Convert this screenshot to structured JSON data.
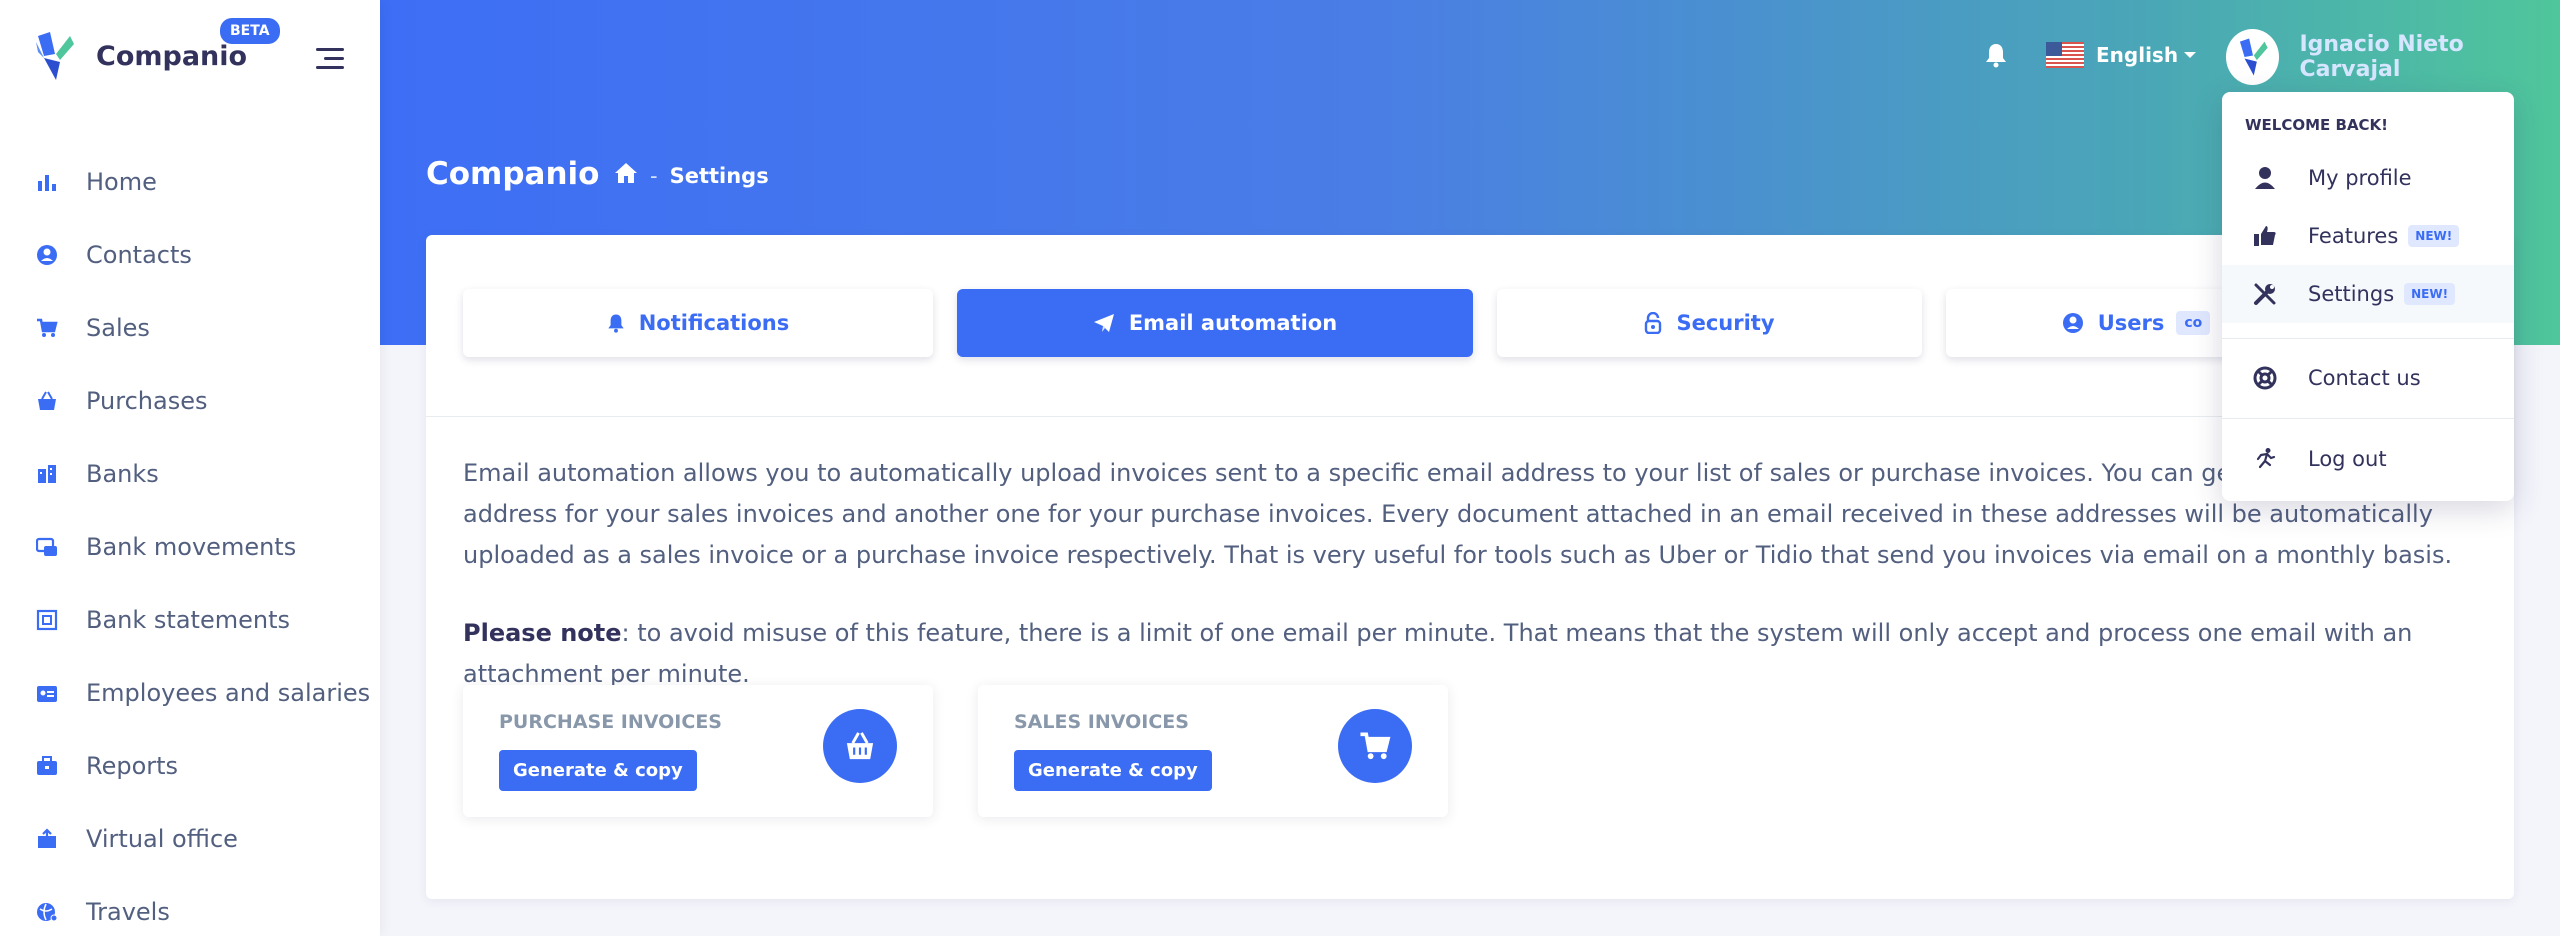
{
  "app": {
    "name": "Companio",
    "badge": "BETA"
  },
  "sidebar": {
    "items": [
      {
        "label": "Home",
        "icon": "bar-chart-icon"
      },
      {
        "label": "Contacts",
        "icon": "user-circle-icon"
      },
      {
        "label": "Sales",
        "icon": "cart-icon"
      },
      {
        "label": "Purchases",
        "icon": "basket-icon"
      },
      {
        "label": "Banks",
        "icon": "bank-icon"
      },
      {
        "label": "Bank movements",
        "icon": "transfer-icon"
      },
      {
        "label": "Bank statements",
        "icon": "statement-icon"
      },
      {
        "label": "Employees and salaries",
        "icon": "id-badge-icon"
      },
      {
        "label": "Reports",
        "icon": "briefcase-icon"
      },
      {
        "label": "Virtual office",
        "icon": "office-box-icon"
      },
      {
        "label": "Travels",
        "icon": "globe-icon"
      }
    ]
  },
  "header": {
    "language": "English",
    "user_name": "Ignacio Nieto Carvajal",
    "page_title": "Companio",
    "breadcrumb": {
      "separator": "-",
      "current": "Settings"
    }
  },
  "tabs": [
    {
      "label": "Notifications",
      "icon": "bell-icon"
    },
    {
      "label": "Email automation",
      "icon": "paper-plane-icon",
      "active": true
    },
    {
      "label": "Security",
      "icon": "lock-icon"
    },
    {
      "label": "Users",
      "icon": "user-circle-icon",
      "badge": "co"
    }
  ],
  "content": {
    "description": "Email automation allows you to automatically upload invoices sent to a specific email address to your list of sales or purchase invoices. You can generate one email address for your sales invoices and another one for your purchase invoices. Every document attached in an email received in these addresses will be automatically uploaded as a sales invoice or a purchase invoice respectively. That is very useful for tools such as Uber or Tidio that send you invoices via email on a monthly basis.",
    "note_label": "Please note",
    "note_text": ": to avoid misuse of this feature, there is a limit of one email per minute. That means that the system will only accept and process one email with an attachment per minute.",
    "purchase": {
      "title": "PURCHASE INVOICES",
      "button": "Generate & copy"
    },
    "sales": {
      "title": "SALES INVOICES",
      "button": "Generate & copy"
    }
  },
  "dropdown": {
    "header": "WELCOME BACK!",
    "items": [
      {
        "label": "My profile",
        "icon": "user-icon"
      },
      {
        "label": "Features",
        "icon": "thumbs-up-icon",
        "badge": "NEW!"
      },
      {
        "label": "Settings",
        "icon": "tools-icon",
        "badge": "NEW!"
      },
      {
        "label": "Contact us",
        "icon": "lifebuoy-icon"
      },
      {
        "label": "Log out",
        "icon": "running-icon"
      }
    ]
  },
  "colors": {
    "primary": "#3b6cf4",
    "gradient_end": "#4fc69b"
  }
}
